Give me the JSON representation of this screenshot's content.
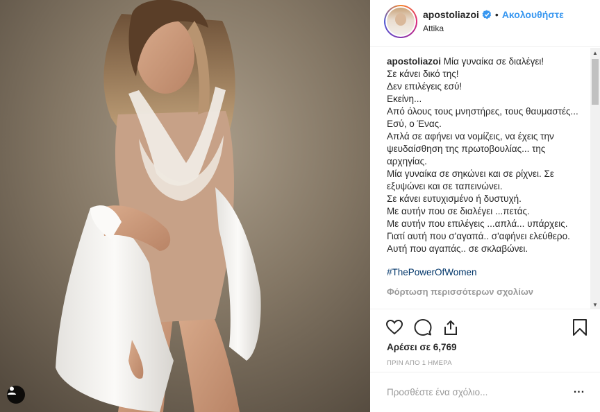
{
  "post": {
    "username": "apostoliazoi",
    "follow_label": "Ακολουθήστε",
    "separator": "•",
    "location": "Attika"
  },
  "caption": {
    "username": "apostoliazoi",
    "lines": [
      "Μία γυναίκα σε διαλέγει!",
      "Σε κάνει δικό της!",
      "Δεν επιλέγεις εσύ!",
      "Εκείνη...",
      "Από όλους τους μνηστήρες, τους θαυμαστές... Εσύ, ο Ένας.",
      "Απλά σε αφήνει να νομίζεις, να έχεις την ψευδαίσθηση της πρωτοβουλίας... της αρχηγίας.",
      "Μία γυναίκα σε σηκώνει και σε ρίχνει. Σε εξυψώνει και σε ταπεινώνει.",
      "Σε κάνει ευτυχισμένο ή δυστυχή.",
      "Με αυτήν που σε διαλέγει ...πετάς.",
      "Με αυτήν που επιλέγεις ...απλά... υπάρχεις.",
      "Γιατί αυτή που σ'αγαπά.. σ'αφήνει ελεύθερο.",
      "Αυτή που αγαπάς.. σε σκλαβώνει."
    ],
    "hashtag": "#ThePowerOfWomen",
    "load_more": "Φόρτωση περισσότερων σχολίων"
  },
  "actions": {
    "likes_text": "Αρέσει σε 6,769",
    "time_text": "ΠΡΙΝ ΑΠΟ 1 ΗΜΕΡΑ"
  },
  "comment": {
    "placeholder": "Προσθέστε ένα σχόλιο...",
    "more_label": "..."
  },
  "icons": {
    "verified": "verified-badge-icon",
    "like": "heart-icon",
    "comment": "comment-bubble-icon",
    "share": "share-icon",
    "save": "bookmark-icon",
    "tag": "user-tag-icon"
  },
  "colors": {
    "accent": "#3897f0",
    "hashtag": "#003569",
    "muted": "#999999",
    "text": "#262626"
  }
}
